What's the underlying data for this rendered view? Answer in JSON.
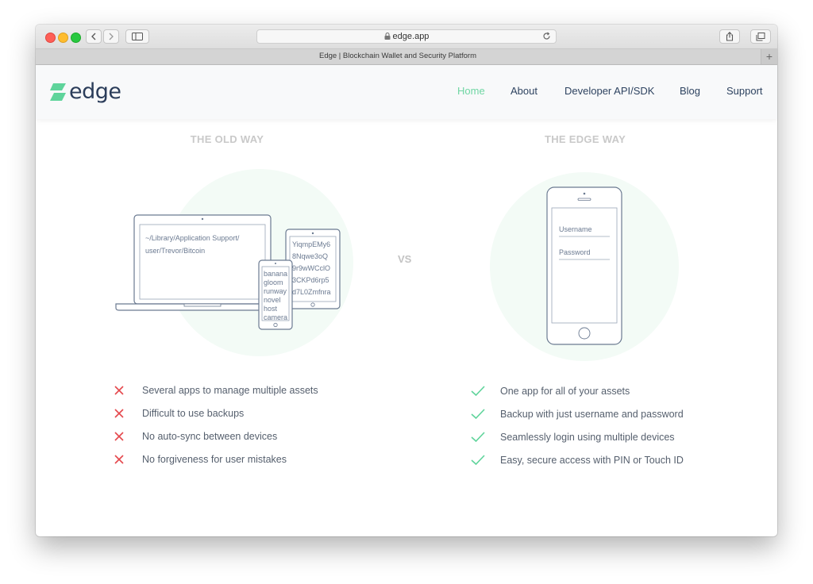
{
  "browser": {
    "url": "edge.app",
    "tab_title": "Edge | Blockchain Wallet and Security Platform",
    "new_tab": "+"
  },
  "site": {
    "logo_text": "edge",
    "nav": [
      {
        "label": "Home",
        "active": true
      },
      {
        "label": "About",
        "active": false
      },
      {
        "label": "Developer API/SDK",
        "active": false
      },
      {
        "label": "Blog",
        "active": false
      },
      {
        "label": "Support",
        "active": false
      }
    ]
  },
  "comparison": {
    "old_title": "THE OLD WAY",
    "new_title": "THE EDGE WAY",
    "vs": "VS",
    "old_illustration": {
      "path_line1": "~/Library/Application Support/",
      "path_line2": "user/Trevor/Bitcoin",
      "tablet_lines": [
        "YiqmpEMy6",
        "8Nqwe3oQ",
        "9r9wWCclO",
        "3CKPd6rp5",
        "d7L0Zmfnra"
      ],
      "phone_words": [
        "banana",
        "gloom",
        "runway",
        "novel",
        "host",
        "camera"
      ]
    },
    "edge_illustration": {
      "username_label": "Username",
      "password_label": "Password"
    },
    "old_items": [
      "Several apps to manage multiple assets",
      "Difficult to use backups",
      "No auto-sync between devices",
      "No forgiveness for user mistakes"
    ],
    "new_items": [
      "One app for all of your assets",
      "Backup with just username and password",
      "Seamlessly login using multiple devices",
      "Easy, secure access with PIN or Touch ID"
    ]
  },
  "colors": {
    "accent_green": "#6fd6a3",
    "brand_navy": "#2b3d5a",
    "cross_red": "#e5484d",
    "check_green": "#5fd49b"
  }
}
